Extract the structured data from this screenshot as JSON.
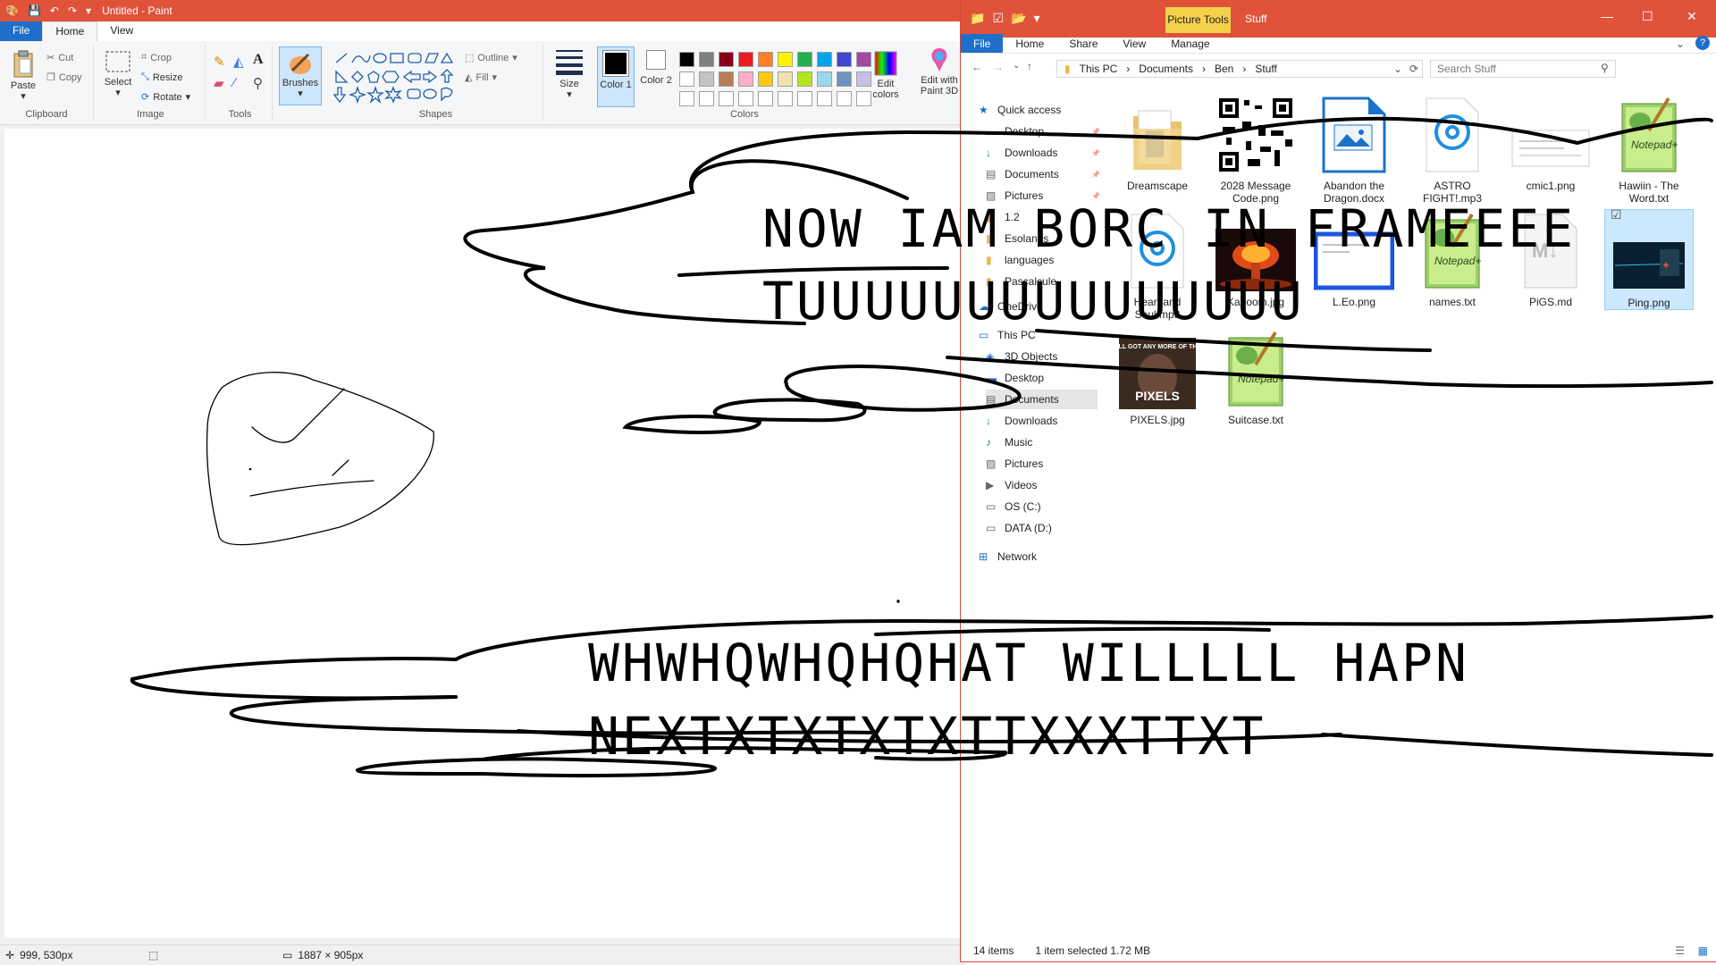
{
  "paint": {
    "title": "Untitled - Paint",
    "tabs": [
      "File",
      "Home",
      "View"
    ],
    "clipboard": {
      "paste": "Paste",
      "cut": "Cut",
      "copy": "Copy",
      "label": "Clipboard"
    },
    "image": {
      "select": "Select",
      "crop": "Crop",
      "resize": "Resize",
      "rotate": "Rotate",
      "label": "Image"
    },
    "tools": {
      "label": "Tools"
    },
    "brushes": "Brushes",
    "shapes": {
      "outline": "Outline",
      "fill": "Fill",
      "label": "Shapes"
    },
    "size": "Size",
    "color1": "Color 1",
    "color2": "Color 2",
    "colors_label": "Colors",
    "edit_colors": "Edit colors",
    "edit_paint3d": "Edit with Paint 3D",
    "palette": [
      "#000000",
      "#7f7f7f",
      "#880015",
      "#ed1c24",
      "#ff7f27",
      "#fff200",
      "#22b14c",
      "#00a2e8",
      "#3f48cc",
      "#a349a4",
      "#ffffff",
      "#c3c3c3",
      "#b97a57",
      "#ffaec9",
      "#ffc90e",
      "#efe4b0",
      "#b5e61d",
      "#99d9ea",
      "#7092be",
      "#c8bfe7"
    ],
    "status": {
      "cursor": "999, 530px",
      "selection": "",
      "canvas_size": "1887 × 905px"
    }
  },
  "explorer": {
    "context_tab": "Picture Tools",
    "title": "Stuff",
    "tabs": [
      "File",
      "Home",
      "Share",
      "View",
      "Manage"
    ],
    "breadcrumb": [
      "This PC",
      "Documents",
      "Ben",
      "Stuff"
    ],
    "search_placeholder": "Search Stuff",
    "nav": [
      {
        "label": "Quick access",
        "icon": "star-icon",
        "top": 0
      },
      {
        "label": "Desktop",
        "icon": "desktop-icon"
      },
      {
        "label": "Downloads",
        "icon": "download-icon"
      },
      {
        "label": "Documents",
        "icon": "documents-icon"
      },
      {
        "label": "Pictures",
        "icon": "pictures-icon"
      },
      {
        "label": "1.2",
        "icon": "folder-icon"
      },
      {
        "label": "Esolangs",
        "icon": "folder-icon"
      },
      {
        "label": "languages",
        "icon": "folder-icon"
      },
      {
        "label": "Pascalcule",
        "icon": "folder-icon"
      },
      {
        "label": "OneDrive",
        "icon": "cloud-icon"
      },
      {
        "label": "This PC",
        "icon": "pc-icon"
      },
      {
        "label": "3D Objects",
        "icon": "cube-icon"
      },
      {
        "label": "Desktop",
        "icon": "desktop-icon"
      },
      {
        "label": "Documents",
        "icon": "documents-icon"
      },
      {
        "label": "Downloads",
        "icon": "download-icon"
      },
      {
        "label": "Music",
        "icon": "music-icon"
      },
      {
        "label": "Pictures",
        "icon": "pictures-icon"
      },
      {
        "label": "Videos",
        "icon": "video-icon"
      },
      {
        "label": "OS (C:)",
        "icon": "drive-icon"
      },
      {
        "label": "DATA (D:)",
        "icon": "drive-icon"
      },
      {
        "label": "Network",
        "icon": "network-icon"
      }
    ],
    "files": [
      {
        "name": "Dreamscape",
        "type": "folder"
      },
      {
        "name": "2028 Message Code.png",
        "type": "qr"
      },
      {
        "name": "Abandon the Dragon.docx",
        "type": "docx"
      },
      {
        "name": "ASTRO FIGHT!.mp3",
        "type": "audio"
      },
      {
        "name": "cmic1.png",
        "type": "image-white"
      },
      {
        "name": "Hawiin - The Word.txt",
        "type": "notepad"
      },
      {
        "name": "Heart and Soul.mp3",
        "type": "audio"
      },
      {
        "name": "Kaboom.jpg",
        "type": "explosion"
      },
      {
        "name": "L.Eo.png",
        "type": "screenshot"
      },
      {
        "name": "names.txt",
        "type": "notepad"
      },
      {
        "name": "PiGS.md",
        "type": "markdown"
      },
      {
        "name": "Ping.png",
        "type": "ping",
        "selected": true
      },
      {
        "name": "PIXELS.jpg",
        "type": "meme"
      },
      {
        "name": "Suitcase.txt",
        "type": "notepad"
      }
    ],
    "meme_text_top": "Y'ALL GOT ANY MORE OF THEM",
    "meme_text_bottom": "PIXELS",
    "status": {
      "count": "14 items",
      "selected": "1 item selected  1.72 MB"
    }
  },
  "drawing": {
    "line1": "NOW IAM BORC IN FRAMEEEE",
    "line2": "TUUUUUUUUUUUUUUU",
    "line3": "WHWHQWHQHQHAT WILLLLL HAPN",
    "line4": "NEXTXTXTXTXTTXXXTTXT"
  }
}
